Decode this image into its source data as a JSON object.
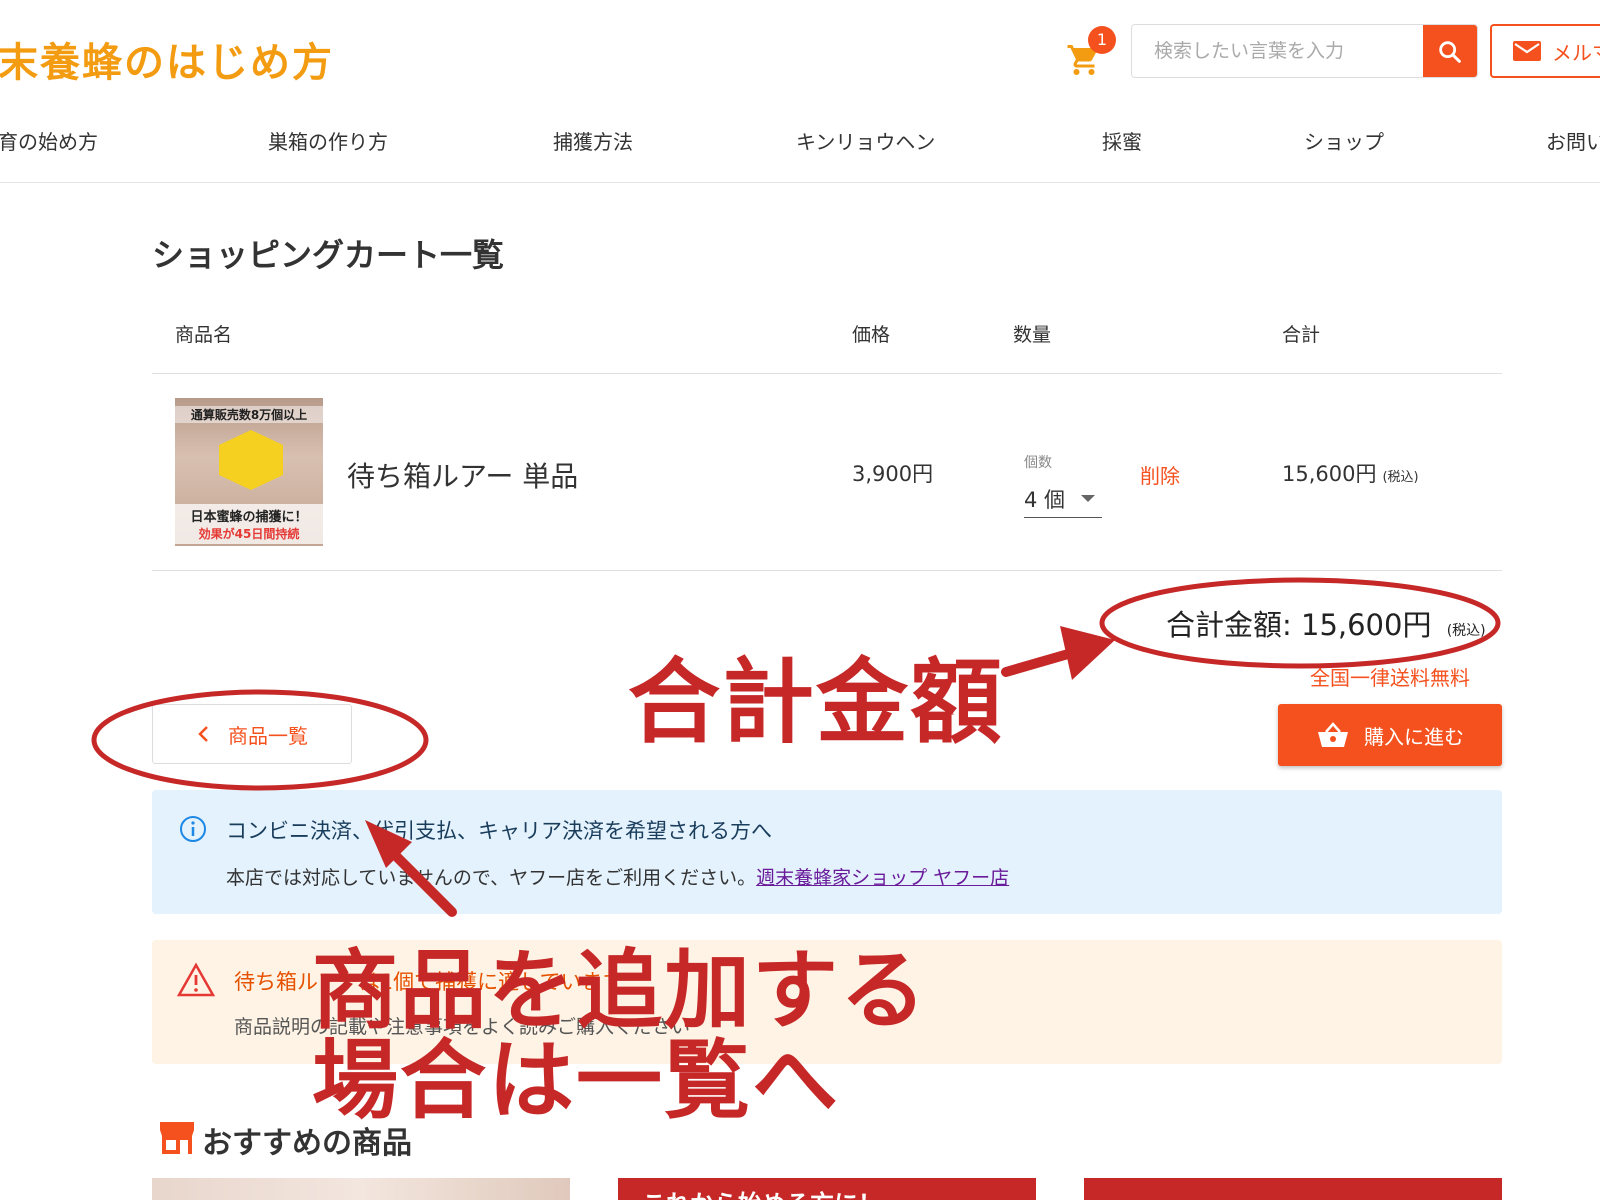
{
  "header": {
    "logo": "末養蜂のはじめ方",
    "cart_count": "1",
    "search_placeholder": "検索したい言葉を入力",
    "mail_label": "メルマ"
  },
  "nav": {
    "items": [
      "育の始め方",
      "巣箱の作り方",
      "捕獲方法",
      "キンリョウヘン",
      "採蜜",
      "ショップ",
      "お問い"
    ]
  },
  "cart": {
    "title": "ショッピングカート一覧",
    "columns": {
      "name": "商品名",
      "price": "価格",
      "qty": "数量",
      "total": "合計"
    },
    "item": {
      "image_top_text": "通算販売数8万個以上",
      "image_bottom_1": "日本蜜蜂の捕獲に！",
      "image_bottom_2": "効果が45日間持続",
      "name": "待ち箱ルアー 単品",
      "price": "3,900円",
      "qty_label": "個数",
      "qty_value": "4 個",
      "delete_label": "削除",
      "line_total": "15,600円",
      "tax_label": "(税込)"
    },
    "grand_total_label": "合計金額: 15,600円",
    "grand_total_tax": "(税込)",
    "shipping_note": "全国一律送料無料",
    "buy_button": "購入に進む",
    "back_button": "商品一覧"
  },
  "info": {
    "title": "コンビニ決済、代引支払、キャリア決済を希望される方へ",
    "body": "本店では対応していませんので、ヤフー店をご利用ください。",
    "link": "週末養蜂家ショップ ヤフー店"
  },
  "warning": {
    "title": "待ち箱ルアーは1個で捕獲に適しています",
    "body": "商品説明の記載や注意事項をよく読みご購入ください"
  },
  "recommend": {
    "title": "おすすめの商品",
    "card2_text": "これから始める方に！"
  },
  "annotations": {
    "total_label": "合計金額",
    "add_line1": "商品を追加する",
    "add_line2": "場合は一覧へ"
  },
  "colors": {
    "logo": "#f39c12",
    "accent": "#f4511e",
    "annotation": "#c62828",
    "info_bg": "#e3f2fd",
    "warn_bg": "#fef3e4"
  }
}
